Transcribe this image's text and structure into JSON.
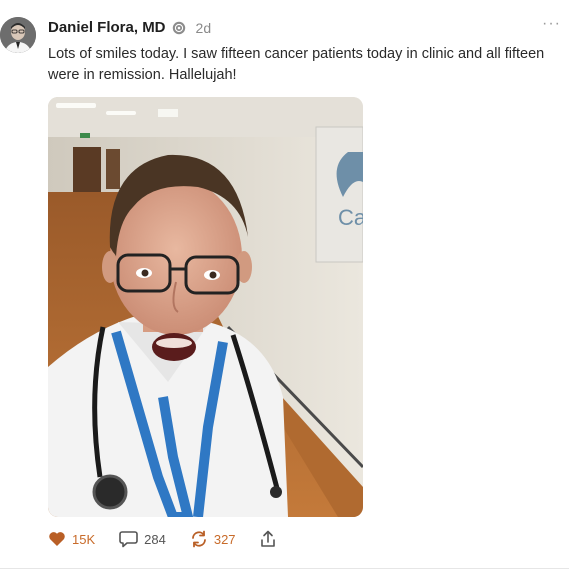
{
  "post": {
    "author": "Daniel Flora, MD",
    "time": "2d",
    "more_label": "···",
    "text": "Lots of smiles today. I saw fifteen cancer patients today in clinic and all fifteen were in remission. Hallelujah!",
    "actions": {
      "likes": "15K",
      "comments": "284",
      "restacks": "327"
    }
  },
  "colors": {
    "accent": "#c86b2a",
    "muted": "#8a8a8a"
  },
  "icons": [
    "avatar",
    "verified-badge-icon",
    "more-options-icon",
    "heart-icon",
    "comment-icon",
    "restack-icon",
    "share-icon"
  ]
}
